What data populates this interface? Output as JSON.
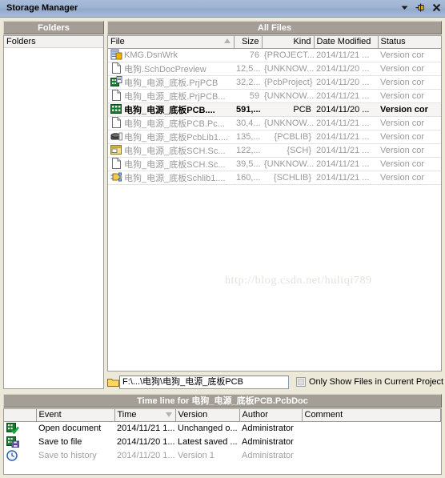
{
  "window": {
    "title": "Storage Manager",
    "controls": [
      {
        "name": "dropdown-arrow",
        "glyph": "▼"
      },
      {
        "name": "auto-hide-pin",
        "glyph": "pin"
      },
      {
        "name": "close",
        "glyph": "✕"
      }
    ]
  },
  "folders_panel": {
    "caption": "Folders",
    "root_label": "Folders"
  },
  "files_panel": {
    "caption": "All Files",
    "columns": [
      "File",
      "Size",
      "Kind",
      "Date Modified",
      "Status"
    ],
    "sort_column": "File",
    "sort_direction": "asc",
    "rows": [
      {
        "icon": "dsnwrk-icon",
        "file": "KMG.DsnWrk",
        "size": "76",
        "kind": "{PROJECT...",
        "date": "2014/11/21 ...",
        "status": "Version cor",
        "selected": false
      },
      {
        "icon": "page-icon",
        "file": "电狗.SchDocPreview",
        "size": "12,5...",
        "kind": "{UNKNOW...",
        "date": "2014/11/20 ...",
        "status": "Version cor",
        "selected": false
      },
      {
        "icon": "pcbproject-icon",
        "file": "电狗_电源_底板.PrjPCB",
        "size": "32,2...",
        "kind": "{PcbProject}",
        "date": "2014/11/20 ...",
        "status": "Version cor",
        "selected": false
      },
      {
        "icon": "page-icon",
        "file": "电狗_电源_底板.PrjPCB...",
        "size": "59",
        "kind": "{UNKNOW...",
        "date": "2014/11/21 ...",
        "status": "Version cor",
        "selected": false
      },
      {
        "icon": "pcb-icon",
        "file": "电狗_电源_底板PCB....",
        "size": "591,...",
        "kind": "PCB",
        "date": "2014/11/20 ...",
        "status": "Version cor",
        "selected": true
      },
      {
        "icon": "page-icon",
        "file": "电狗_电源_底板PCB.Pc...",
        "size": "30,4...",
        "kind": "{UNKNOW...",
        "date": "2014/11/21 ...",
        "status": "Version cor",
        "selected": false
      },
      {
        "icon": "pcblib-icon",
        "file": "电狗_电源_底板PcbLib1....",
        "size": "135,...",
        "kind": "{PCBLIB}",
        "date": "2014/11/21 ...",
        "status": "Version cor",
        "selected": false
      },
      {
        "icon": "sch-icon",
        "file": "电狗_电源_底板SCH.Sc...",
        "size": "122,...",
        "kind": "{SCH}",
        "date": "2014/11/21 ...",
        "status": "Version cor",
        "selected": false
      },
      {
        "icon": "page-icon",
        "file": "电狗_电源_底板SCH.Sc...",
        "size": "39,5...",
        "kind": "{UNKNOW...",
        "date": "2014/11/21 ...",
        "status": "Version cor",
        "selected": false
      },
      {
        "icon": "schlib-icon",
        "file": "电狗_电源_底板Schlib1....",
        "size": "160,...",
        "kind": "{SCHLIB}",
        "date": "2014/11/21 ...",
        "status": "Version cor",
        "selected": false
      }
    ],
    "watermark": "http://blog.csdn.net/huliqi789",
    "path_value": "F:\\...\\电狗\\电狗_电源_底板PCB",
    "only_project_label": "Only Show Files in Current Project",
    "only_project_checked": false
  },
  "timeline_panel": {
    "caption": "Time line for 电狗_电源_底板PCB.PcbDoc",
    "columns": [
      "Event",
      "Time",
      "Version",
      "Author",
      "Comment"
    ],
    "sort_column": "Time",
    "rows": [
      {
        "icon": "open-document-icon",
        "event": "Open document",
        "time": "2014/11/21 1...",
        "version": "Unchanged o...",
        "author": "Administrator",
        "comment": "",
        "dim": false
      },
      {
        "icon": "save-to-file-icon",
        "event": "Save to file",
        "time": "2014/11/20 1...",
        "version": "Latest saved ...",
        "author": "Administrator",
        "comment": "",
        "dim": false
      },
      {
        "icon": "clock-icon",
        "event": "Save to history",
        "time": "2014/11/20 1...",
        "version": "Version 1",
        "author": "Administrator",
        "comment": "",
        "dim": true
      }
    ]
  },
  "colors": {
    "titlebar": "#9db3d2",
    "panel_caption": "#a49e97",
    "window_bg": "#ece9d8",
    "list_bg": "#ffffff",
    "dim_text": "#9a9a9a"
  }
}
